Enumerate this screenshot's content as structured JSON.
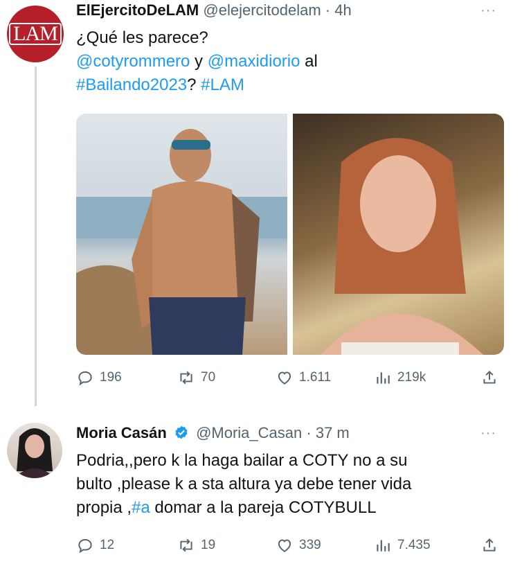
{
  "tweet1": {
    "name": "ElEjercitoDeLAM",
    "handle": "@elejercitodelam",
    "time": "4h",
    "avatar_text": "LAM",
    "line1": "¿Qué les parece?",
    "mention1": "@cotyrommero",
    "and": " y ",
    "mention2": "@maxidiorio",
    "al": " al",
    "hashtag1": "#Bailando2023",
    "q": "? ",
    "hashtag2": "#LAM",
    "media": [
      "shirtless-man-beach-photo",
      "young-woman-photo"
    ],
    "stats": {
      "replies": "196",
      "reposts": "70",
      "likes": "1.611",
      "views": "219k"
    }
  },
  "tweet2": {
    "name": "Moria Casán",
    "handle": "@Moria_Casan",
    "time": "37 m",
    "line1": "Podria,,pero k la haga bailar a COTY no a su",
    "line2": "bulto ,please k a sta altura ya debe tener vida",
    "line3_pre": "propia ,",
    "line3_hash": "#a",
    "line3_post": " domar a la pareja COTYBULL",
    "stats": {
      "replies": "12",
      "reposts": "19",
      "likes": "339",
      "views": "7.435"
    }
  },
  "more_label": "···",
  "dot": " · ",
  "colors": {
    "link": "#1d9bf0",
    "muted": "#536471",
    "lam_red": "#b51f2a",
    "verified": "#1d9bf0"
  }
}
